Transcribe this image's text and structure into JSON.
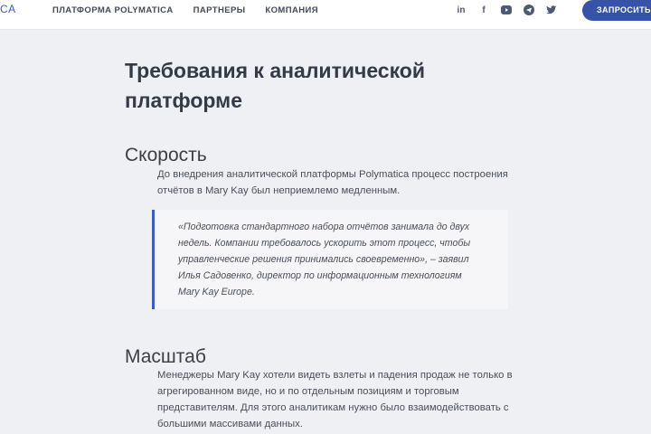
{
  "header": {
    "logo_fragment": "CA",
    "nav": [
      {
        "label": "ПЛАТФОРМА POLYMATICA"
      },
      {
        "label": "ПАРТНЕРЫ"
      },
      {
        "label": "КОМПАНИЯ"
      }
    ],
    "social": [
      {
        "icon": "linkedin-icon",
        "glyph": "in"
      },
      {
        "icon": "facebook-icon",
        "glyph": "f"
      },
      {
        "icon": "youtube-icon",
        "glyph": "▶"
      },
      {
        "icon": "telegram-icon",
        "glyph": "➤"
      },
      {
        "icon": "twitter-icon",
        "glyph": "🐦"
      }
    ],
    "cta_label": "ЗАПРОСИТЬ"
  },
  "article": {
    "title": "Требования к аналитической платформе",
    "sections": [
      {
        "heading": "Скорость",
        "paragraph": "До внедрения аналитической платформы Polymatica процесс построения отчётов в Mary Kay был неприемлемо медленным.",
        "quote": "«Подготовка стандартного набора отчётов занимала до двух недель. Компании требовалось ускорить этот процесс, чтобы управленческие решения принимались своевременно», – заявил Илья Садовенко, директор по информационным технологиям Mary Kay Europe."
      },
      {
        "heading": "Масштаб",
        "paragraph": "Менеджеры Mary Kay хотели видеть взлеты и падения продаж не только в агрегированном виде, но и по отдельным позициям и торговым представителям. Для этого аналитикам нужно было взаимодействовать с большими массивами данных."
      }
    ]
  },
  "colors": {
    "accent": "#3653a8",
    "quote_border": "#3b5bc7",
    "background": "#eef0f3"
  }
}
